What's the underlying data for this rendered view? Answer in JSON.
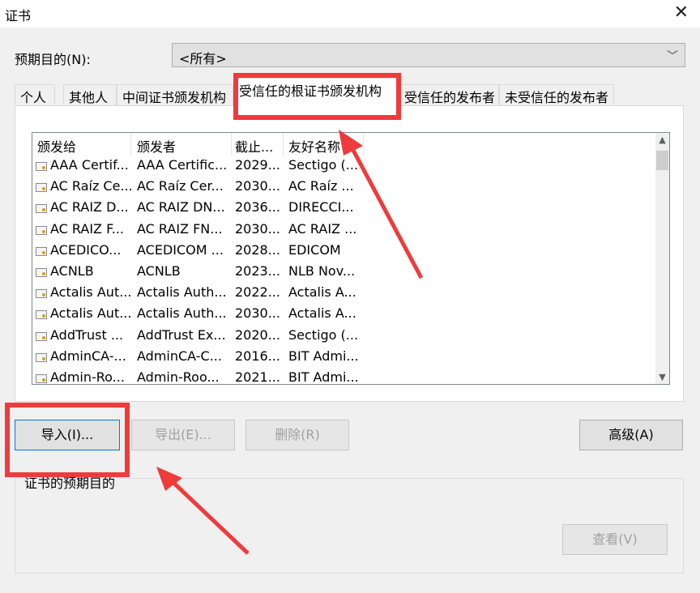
{
  "window": {
    "title": "证书",
    "close_glyph": "✕"
  },
  "purpose": {
    "label": "预期目的(N):",
    "selected": "<所有>"
  },
  "tabs": [
    {
      "label": "个人",
      "active": false
    },
    {
      "label": "其他人",
      "active": false
    },
    {
      "label": "中间证书颁发机构",
      "active": false
    },
    {
      "label": "受信任的根证书颁发机构",
      "active": true
    },
    {
      "label": "受信任的发布者",
      "active": false
    },
    {
      "label": "未受信任的发布者",
      "active": false
    }
  ],
  "list": {
    "columns": [
      "颁发给",
      "颁发者",
      "截止...",
      "友好名称"
    ],
    "rows": [
      [
        "AAA Certif...",
        "AAA Certific...",
        "2029...",
        "Sectigo (..."
      ],
      [
        "AC Raíz Ce...",
        "AC Raíz Cer...",
        "2030...",
        "AC Raíz ..."
      ],
      [
        "AC RAIZ D...",
        "AC RAIZ DN...",
        "2036...",
        "DIRECCI..."
      ],
      [
        "AC RAIZ F...",
        "AC RAIZ FN...",
        "2030...",
        "AC RAIZ ..."
      ],
      [
        "ACEDICO...",
        "ACEDICOM ...",
        "2028...",
        "EDICOM"
      ],
      [
        "ACNLB",
        "ACNLB",
        "2023...",
        "NLB Nov..."
      ],
      [
        "Actalis Aut...",
        "Actalis Auth...",
        "2022...",
        "Actalis A..."
      ],
      [
        "Actalis Aut...",
        "Actalis Auth...",
        "2030...",
        "Actalis A..."
      ],
      [
        "AddTrust ...",
        "AddTrust Ex...",
        "2020...",
        "Sectigo (..."
      ],
      [
        "AdminCA-...",
        "AdminCA-C...",
        "2016...",
        "BIT Admi..."
      ],
      [
        "Admin-Ro...",
        "Admin-Roo...",
        "2021...",
        "BIT Admi..."
      ]
    ]
  },
  "buttons": {
    "import": "导入(I)...",
    "export": "导出(E)...",
    "delete": "删除(R)",
    "advanced": "高级(A)",
    "view": "查看(V)"
  },
  "group": {
    "label": "证书的预期目的"
  },
  "annotation_color": "#ee3b3b"
}
